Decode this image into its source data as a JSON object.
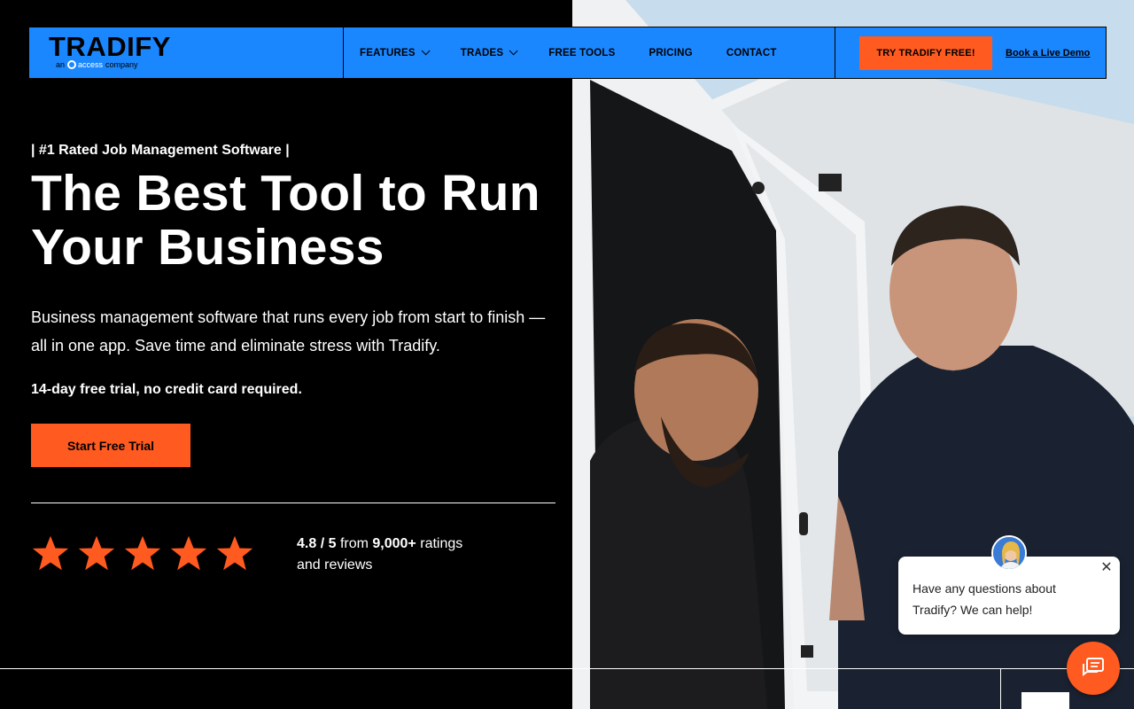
{
  "brand": {
    "logo_text": "TRADIFY",
    "sub_prefix": "an",
    "sub_access": "access",
    "sub_suffix": "company",
    "accent_color": "#ff5a1f",
    "nav_color": "#1b87ff"
  },
  "nav": {
    "items": [
      {
        "label": "FEATURES",
        "has_dropdown": true
      },
      {
        "label": "TRADES",
        "has_dropdown": true
      },
      {
        "label": "FREE TOOLS",
        "has_dropdown": false
      },
      {
        "label": "PRICING",
        "has_dropdown": false
      },
      {
        "label": "CONTACT",
        "has_dropdown": false
      }
    ],
    "try_button": "TRY TRADIFY FREE!",
    "demo_link": "Book a Live Demo"
  },
  "hero": {
    "eyebrow": "| #1 Rated Job Management Software |",
    "headline": "The Best Tool to Run Your Business",
    "description": "Business management software that runs every job from start to finish — all in one app. Save time and eliminate stress with Tradify.",
    "trial_note": "14-day free trial, no credit card required.",
    "cta": "Start Free Trial"
  },
  "rating": {
    "stars": 5,
    "score": "4.8 / 5",
    "from": "from",
    "count": "9,000+",
    "suffix_1": "ratings",
    "suffix_2": "and reviews"
  },
  "chat": {
    "message": "Have any questions about Tradify? We can help!",
    "close_icon": "close-icon",
    "launcher_icon": "chat-icon"
  }
}
